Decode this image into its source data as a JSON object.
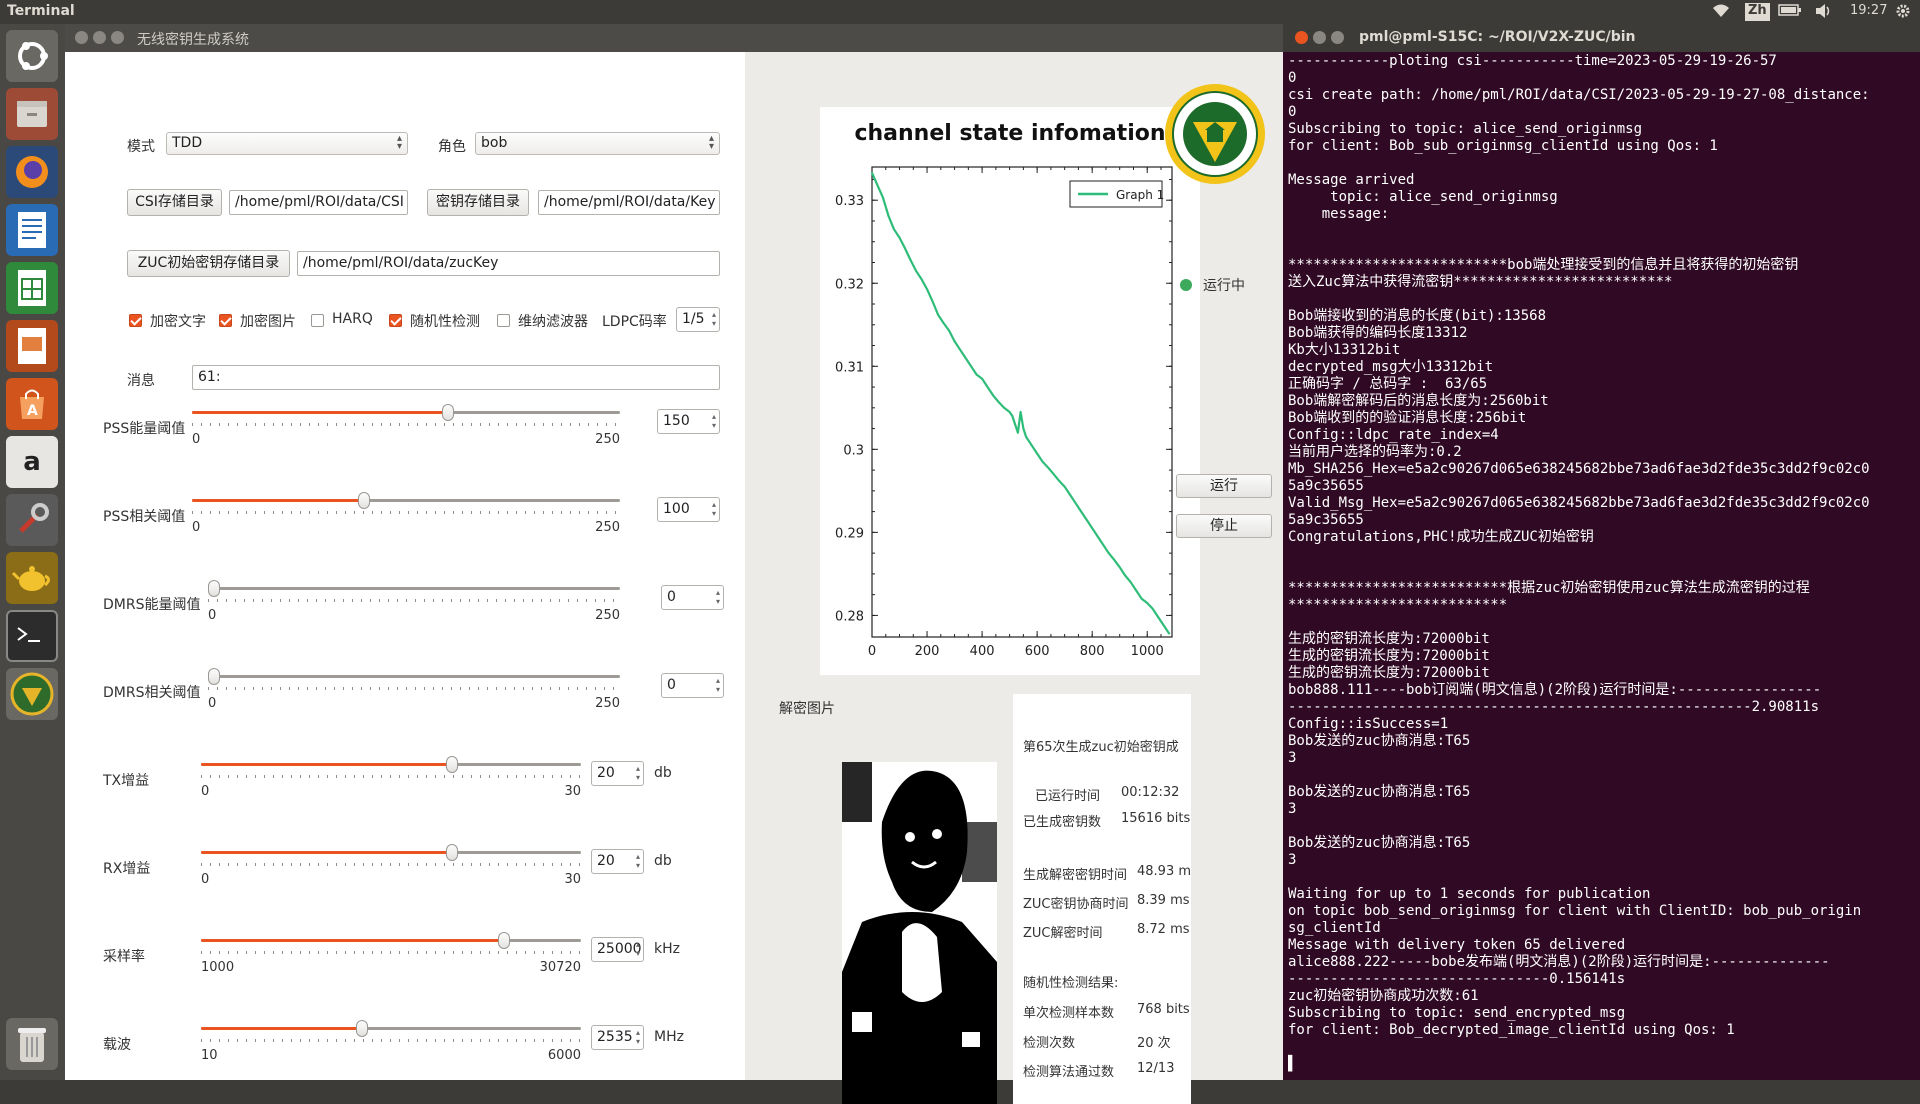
{
  "topbar": {
    "title": "Terminal",
    "lang": "Zh",
    "clock": "19:27"
  },
  "app": {
    "title": "无线密钥生成系统",
    "mode_label": "模式",
    "mode_value": "TDD",
    "role_label": "角色",
    "role_value": "bob",
    "csi_dir_button": "CSI存储目录",
    "csi_dir_value": "/home/pml/ROI/data/CSI",
    "key_dir_button": "密钥存储目录",
    "key_dir_value": "/home/pml/ROI/data/Key",
    "zuc_dir_button": "ZUC初始密钥存储目录",
    "zuc_dir_value": "/home/pml/ROI/data/zucKey",
    "checkboxes": [
      {
        "label": "加密文字",
        "checked": true
      },
      {
        "label": "加密图片",
        "checked": true
      },
      {
        "label": "HARQ",
        "checked": false
      },
      {
        "label": "随机性检测",
        "checked": true
      },
      {
        "label": "维纳滤波器",
        "checked": false
      }
    ],
    "ldpc_label": "LDPC码率",
    "ldpc_value": "1/5",
    "msg_label": "消息",
    "msg_value": "61:",
    "sliders": [
      {
        "label": "PSS能量阈值",
        "min": "0",
        "max": "250",
        "value": "150",
        "fraction": 0.6,
        "unit": ""
      },
      {
        "label": "PSS相关阈值",
        "min": "0",
        "max": "250",
        "value": "100",
        "fraction": 0.4,
        "unit": ""
      },
      {
        "label": "DMRS能量阈值",
        "min": "0",
        "max": "250",
        "value": "0",
        "fraction": 0.0,
        "unit": ""
      },
      {
        "label": "DMRS相关阈值",
        "min": "0",
        "max": "250",
        "value": "0",
        "fraction": 0.0,
        "unit": ""
      },
      {
        "label": "TX增益",
        "min": "0",
        "max": "30",
        "value": "20",
        "fraction": 0.667,
        "unit": "db"
      },
      {
        "label": "RX增益",
        "min": "0",
        "max": "30",
        "value": "20",
        "fraction": 0.667,
        "unit": "db"
      },
      {
        "label": "采样率",
        "min": "1000",
        "max": "30720",
        "value": "25000",
        "fraction": 0.807,
        "unit": "kHz"
      },
      {
        "label": "载波",
        "min": "10",
        "max": "6000",
        "value": "2535",
        "fraction": 0.422,
        "unit": "MHz"
      }
    ],
    "status_label": "运行中",
    "status_color": "#3daa5b",
    "run_button": "运行",
    "stop_button": "停止",
    "decrypted_image_label": "解密图片",
    "stats": {
      "header": "第65次生成zuc初始密钥成",
      "runtime_label": "已运行时间",
      "runtime_value": "00:12:32",
      "keys_label": "已生成密钥数",
      "keys_value": "15616 bits",
      "gen_time_label": "生成解密密钥时间",
      "gen_time_value": "48.93 ms",
      "zuc_neg_label": "ZUC密钥协商时间",
      "zuc_neg_value": "8.39 ms",
      "zuc_dec_label": "ZUC解密时间",
      "zuc_dec_value": "8.72 ms",
      "random_label": "随机性检测结果:",
      "single_label": "单次检测样本数",
      "single_value": "768 bits",
      "count_label": "检测次数",
      "count_value": "20 次",
      "passed_label": "检测算法通过数",
      "passed_value": "12/13"
    }
  },
  "chart_data": {
    "type": "line",
    "title": "channel state infomation",
    "xlabel": "",
    "ylabel": "",
    "xlim": [
      0,
      1090
    ],
    "ylim": [
      0.2774,
      0.334
    ],
    "xticks": [
      "0",
      "200",
      "400",
      "600",
      "800",
      "1000"
    ],
    "yticks": [
      "0.28",
      "0.29",
      "0.3",
      "0.31",
      "0.32",
      "0.33"
    ],
    "series": [
      {
        "name": "Graph 1",
        "color": "#2ebd78",
        "x": [
          0,
          20,
          40,
          60,
          80,
          100,
          120,
          140,
          160,
          180,
          200,
          220,
          240,
          260,
          280,
          300,
          320,
          340,
          360,
          380,
          400,
          420,
          440,
          460,
          480,
          500,
          510,
          520,
          530,
          540,
          550,
          560,
          580,
          600,
          620,
          640,
          660,
          680,
          700,
          720,
          740,
          760,
          780,
          800,
          820,
          840,
          860,
          880,
          900,
          920,
          940,
          960,
          980,
          1000,
          1020,
          1040,
          1060,
          1080
        ],
        "y": [
          0.3333,
          0.3318,
          0.3303,
          0.3281,
          0.3265,
          0.3255,
          0.3242,
          0.3228,
          0.3215,
          0.3205,
          0.3193,
          0.3178,
          0.3162,
          0.3152,
          0.3143,
          0.313,
          0.312,
          0.311,
          0.31,
          0.309,
          0.3085,
          0.3075,
          0.3065,
          0.3057,
          0.305,
          0.3045,
          0.304,
          0.303,
          0.302,
          0.3045,
          0.3025,
          0.3015,
          0.3005,
          0.2995,
          0.2985,
          0.2978,
          0.297,
          0.2962,
          0.2955,
          0.2945,
          0.2935,
          0.2925,
          0.2915,
          0.2905,
          0.2895,
          0.2885,
          0.2875,
          0.2867,
          0.2858,
          0.2848,
          0.284,
          0.283,
          0.282,
          0.2815,
          0.2808,
          0.2798,
          0.2788,
          0.2778
        ]
      }
    ]
  },
  "terminal": {
    "title": "pml@pml-S15C: ~/ROI/V2X-ZUC/bin",
    "lines": [
      "------------ploting csi-----------time=2023-05-29-19-26-57",
      "0",
      "csi create path: /home/pml/ROI/data/CSI/2023-05-29-19-27-08_distance:",
      "0",
      "Subscribing to topic: alice_send_originmsg",
      "for client: Bob_sub_originmsg_clientId using Qos: 1",
      "",
      "Message arrived",
      "     topic: alice_send_originmsg",
      "    message:",
      "",
      "",
      "**************************bob端处理接受到的信息并且将获得的初始密钥",
      "送入Zuc算法中获得流密钥**************************",
      "",
      "Bob端接收到的消息的长度(bit):13568",
      "Bob端获得的编码长度13312",
      "Kb大小13312bit",
      "decrypted_msg大小13312bit",
      "正确码字 / 总码字 :  63/65",
      "Bob端解密解码后的消息长度为:2560bit",
      "Bob端收到的的验证消息长度:256bit",
      "Config::ldpc_rate_index=4",
      "当前用户选择的码率为:0.2",
      "Mb_SHA256_Hex=e5a2c90267d065e638245682bbe73ad6fae3d2fde35c3dd2f9c02c0",
      "5a9c35655",
      "Valid_Msg_Hex=e5a2c90267d065e638245682bbe73ad6fae3d2fde35c3dd2f9c02c0",
      "5a9c35655",
      "Congratulations,PHC!成功生成ZUC初始密钥",
      "",
      "",
      "**************************根据zuc初始密钥使用zuc算法生成流密钥的过程",
      "**************************",
      "",
      "生成的密钥流长度为:72000bit",
      "生成的密钥流长度为:72000bit",
      "生成的密钥流长度为:72000bit",
      "bob888.111----bob订阅端(明文信息)(2阶段)运行时间是:-----------------",
      "-------------------------------------------------------2.90811s",
      "Config::isSuccess=1",
      "Bob发送的zuc协商消息:T65",
      "3",
      "",
      "Bob发送的zuc协商消息:T65",
      "3",
      "",
      "Bob发送的zuc协商消息:T65",
      "3",
      "",
      "Waiting for up to 1 seconds for publication",
      "on topic bob_send_originmsg for client with ClientID: bob_pub_origin",
      "sg_clientId",
      "Message with delivery token 65 delivered",
      "alice888.222-----bobe发布端(明文消息)(2阶段)运行时间是:--------------",
      "-------------------------------0.156141s",
      "zuc初始密钥协商成功次数:61",
      "Subscribing to topic: send_encrypted_msg",
      "for client: Bob_decrypted_image_clientId using Qos: 1",
      "",
      "▌"
    ]
  },
  "launcher": [
    "ubuntu-logo-icon",
    "files-icon",
    "firefox-icon",
    "writer-icon",
    "calc-icon",
    "impress-icon",
    "software-center-icon",
    "amazon-icon",
    "settings-icon",
    "teapot-icon",
    "terminal-icon",
    "university-app-icon",
    "trash-icon"
  ]
}
